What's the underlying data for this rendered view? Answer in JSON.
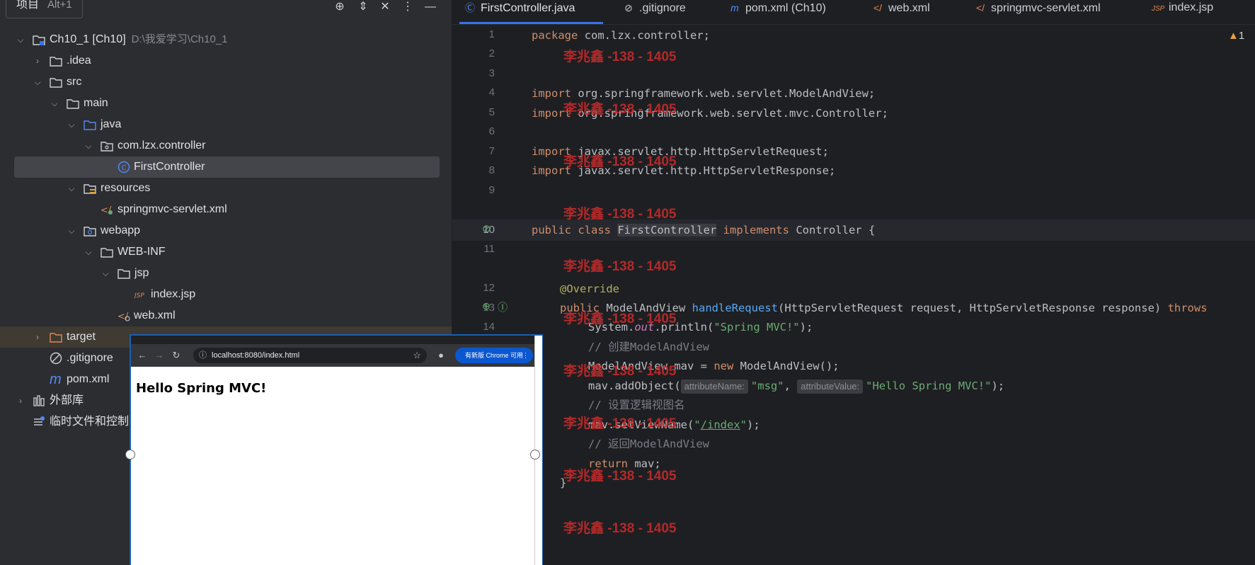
{
  "project_panel": {
    "title": "项目",
    "shortcut": "Alt+1",
    "header_icons": [
      "crosshair-icon",
      "expand-icon",
      "collapse-icon",
      "more-icon",
      "minimize-icon"
    ],
    "root": {
      "label": "Ch10_1 [Ch10]",
      "path": "D:\\我爱学习\\Ch10_1"
    },
    "items": [
      {
        "label": ".idea"
      },
      {
        "label": "src"
      },
      {
        "label": "main"
      },
      {
        "label": "java"
      },
      {
        "label": "com.lzx.controller"
      },
      {
        "label": "FirstController"
      },
      {
        "label": "resources"
      },
      {
        "label": "springmvc-servlet.xml"
      },
      {
        "label": "webapp"
      },
      {
        "label": "WEB-INF"
      },
      {
        "label": "jsp"
      },
      {
        "label": "index.jsp"
      },
      {
        "label": "web.xml"
      },
      {
        "label": "target"
      },
      {
        "label": ".gitignore"
      },
      {
        "label": "pom.xml"
      },
      {
        "label": "外部库"
      },
      {
        "label": "临时文件和控制"
      }
    ]
  },
  "tabs": [
    {
      "label": "FirstController.java",
      "icon": "class-icon"
    },
    {
      "label": ".gitignore",
      "icon": "ignore-icon"
    },
    {
      "label": "pom.xml (Ch10)",
      "icon": "maven-icon"
    },
    {
      "label": "web.xml",
      "icon": "xml-icon"
    },
    {
      "label": "springmvc-servlet.xml",
      "icon": "xml-icon"
    },
    {
      "label": "index.jsp",
      "icon": "jsp-icon"
    }
  ],
  "warning_count": "1",
  "line_numbers": [
    "1",
    "2",
    "3",
    "4",
    "5",
    "6",
    "7",
    "8",
    "9",
    "10",
    "11",
    "12",
    "13",
    "14"
  ],
  "code": {
    "l1_pkg": "package",
    "l1_rest": " com.lzx.controller;",
    "l4_kw": "import",
    "l4_rest": " org.springframework.web.servlet.ModelAndView;",
    "l5_kw": "import",
    "l5_rest": " org.springframework.web.servlet.mvc.Controller;",
    "l7_kw": "import",
    "l7_rest": " javax.servlet.http.HttpServletRequest;",
    "l8_kw": "import",
    "l8_rest": " javax.servlet.http.HttpServletResponse;",
    "l10_kw": "public class",
    "l10_cls": "FirstController",
    "l10_impl": "implements",
    "l10_rest": " Controller {",
    "l12_ann": "@Override",
    "l13_kw": "public",
    "l13_type": " ModelAndView ",
    "l13_fn": "handleRequest",
    "l13_params": "(HttpServletRequest request, HttpServletResponse response) ",
    "l13_throws": "throws",
    "l14_a": "System.",
    "l14_out": "out",
    "l14_b": ".println(",
    "l14_str": "\"Spring MVC!\"",
    "l14_c": ");",
    "c1": "// 创建ModelAndView",
    "l16_a": "ModelAndView mav = ",
    "l16_new": "new",
    "l16_b": " ModelAndView();",
    "l17_a": "mav.addObject(",
    "hint_name": "attributeName:",
    "l17_str1": "\"msg\"",
    "l17_comma": ", ",
    "hint_value": "attributeValue:",
    "l17_str2": "\"Hello Spring MVC!\"",
    "l17_end": ");",
    "c2": "// 设置逻辑视图名",
    "l19_a": "mav.setViewName(",
    "l19_q1": "\"",
    "l19_link": "/index",
    "l19_q2": "\"",
    "l19_end": ");",
    "c3": "// 返回ModelAndView",
    "l21_kw": "return",
    "l21_rest": " mav;",
    "l22": "}"
  },
  "watermark": "李兆鑫 -138 - 1405",
  "browser": {
    "url": "localhost:8080/index.html",
    "update_label": "有新版 Chrome 可用",
    "heading": "Hello Spring MVC!"
  }
}
